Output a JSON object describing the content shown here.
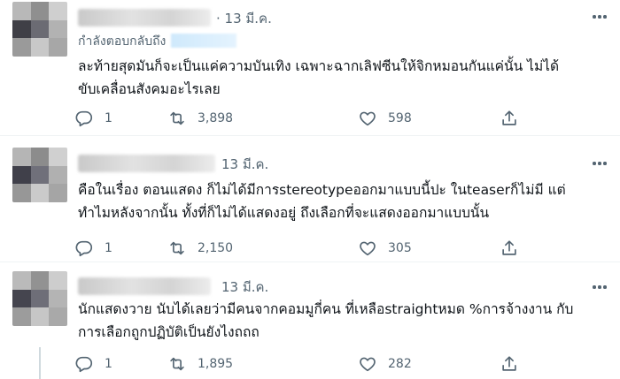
{
  "colors": {
    "text": "#0f1419",
    "muted": "#536471",
    "divider": "#eff3f4"
  },
  "tweets": [
    {
      "date": "13 มี.ค.",
      "replying_to": "กำลังตอบกลับถึง",
      "lines": [
        "ละท้ายสุดมันก็จะเป็นแค่ความบันเทิง เฉพาะฉากเลิฟซีนให้จิกหมอนกันแค่นั้น ไม่ได้",
        "ขับเคลื่อนสังคมอะไรเลย"
      ],
      "replies": "1",
      "retweets": "3,898",
      "likes": "598"
    },
    {
      "date": "13 มี.ค.",
      "lines": [
        "คือในเรื่อง ตอนแสดง ก็ไม่ได้มีการstereotypeออกมาแบบนี้ปะ ในteaserก็ไม่มี แต่",
        "ทำไมหลังจากนั้น ทั้งที่ก็ไม่ได้แสดงอยู่ ถึงเลือกที่จะแสดงออกมาแบบนั้น"
      ],
      "replies": "1",
      "retweets": "2,150",
      "likes": "305"
    },
    {
      "date": "13 มี.ค.",
      "lines": [
        "นักแสดงวาย นับได้เลยว่ามีคนจากคอมมูกี่คน ที่เหลือstraightหมด %การจ้างงาน กับ",
        "การเลือกถูกปฏิบัติเป็นยังไงถถถ"
      ],
      "replies": "1",
      "retweets": "1,895",
      "likes": "282"
    }
  ],
  "icons": {
    "reply": "reply-icon",
    "retweet": "retweet-icon",
    "like": "like-icon",
    "share": "share-icon",
    "more": "more-icon"
  }
}
